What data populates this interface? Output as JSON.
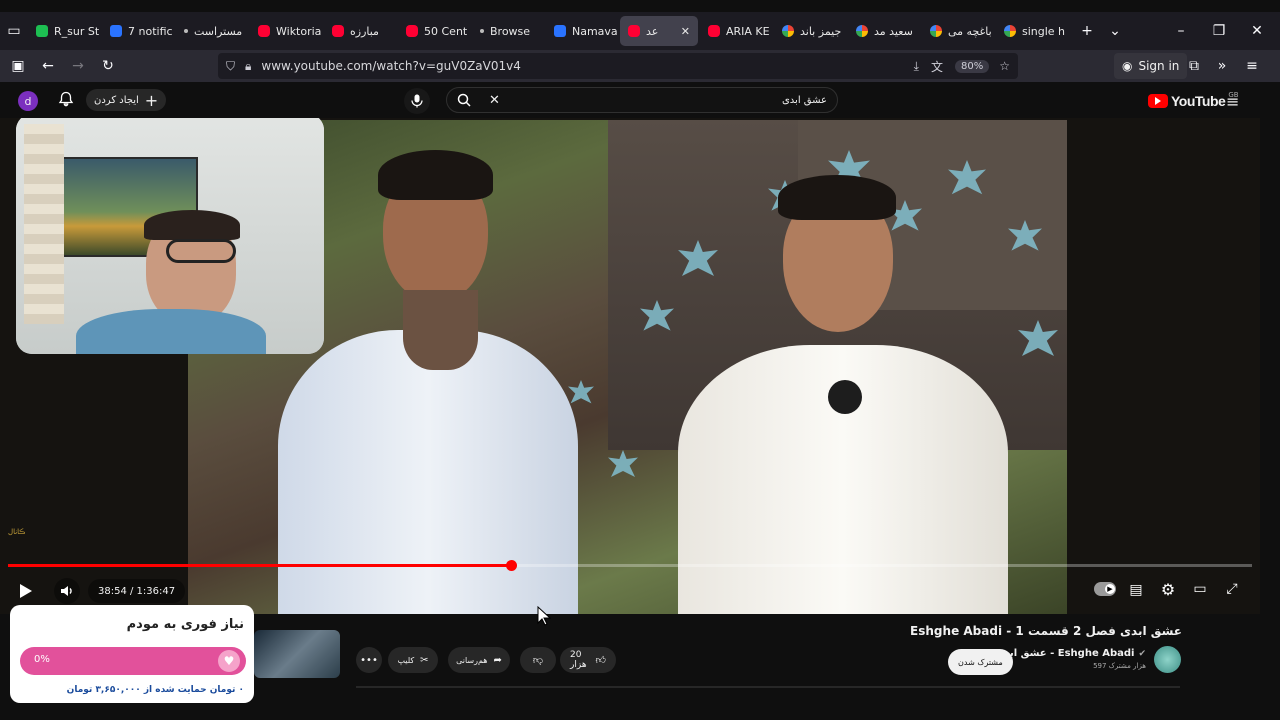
{
  "browser": {
    "tabs": [
      {
        "label": "R_sur Sti",
        "icon": "k"
      },
      {
        "label": "7 notific",
        "icon": "n"
      },
      {
        "label": "مستراست",
        "icon": "dot"
      },
      {
        "label": "Wiktoria",
        "icon": "yt"
      },
      {
        "label": "مبارزه",
        "icon": "yt"
      },
      {
        "label": "50 Cent",
        "icon": "yt"
      },
      {
        "label": "Browse",
        "icon": "dot"
      },
      {
        "label": "Namava",
        "icon": "n"
      },
      {
        "label": "عد",
        "icon": "yt"
      },
      {
        "label": "ARIA KE",
        "icon": "yt"
      },
      {
        "label": "جیمز باند",
        "icon": "g"
      },
      {
        "label": "سعید مد",
        "icon": "g"
      },
      {
        "label": "باغچه می",
        "icon": "g"
      },
      {
        "label": "single h",
        "icon": "g"
      }
    ],
    "url": "www.youtube.com/watch?v=guV0ZaV01v4",
    "zoom": "80%",
    "sign_in": "Sign in"
  },
  "youtube": {
    "avatar_letter": "d",
    "create_label": "ایجاد کردن",
    "search_value": "عشق ابدی",
    "logo_text": "YouTube",
    "logo_region": "GB"
  },
  "player": {
    "time_display": "38:54 / 1:36:47",
    "progress_fraction": 0.404,
    "channel_watermark": "ڪانال"
  },
  "video": {
    "title": "عشق ابدی فصل 2 قسمت 1 - Eshghe Abadi",
    "channel_name": "عشق ابدی - Eshghe Abadi",
    "subscribers": "597 هزار مشترک",
    "subscribe_label": "مشترک شدن",
    "like_count": "20 هزار",
    "share_label": "هم‌رسانی",
    "clip_label": "کلیپ"
  },
  "donation": {
    "title": "نیاز فوری به مودم",
    "percent": "0%",
    "status": "۰ تومان حمایت شده از ۳,۶۵۰,۰۰۰ تومان",
    "fill_fraction": 0
  },
  "colors": {
    "accent": "#ff0000",
    "donate_bar": "#e2519b"
  }
}
